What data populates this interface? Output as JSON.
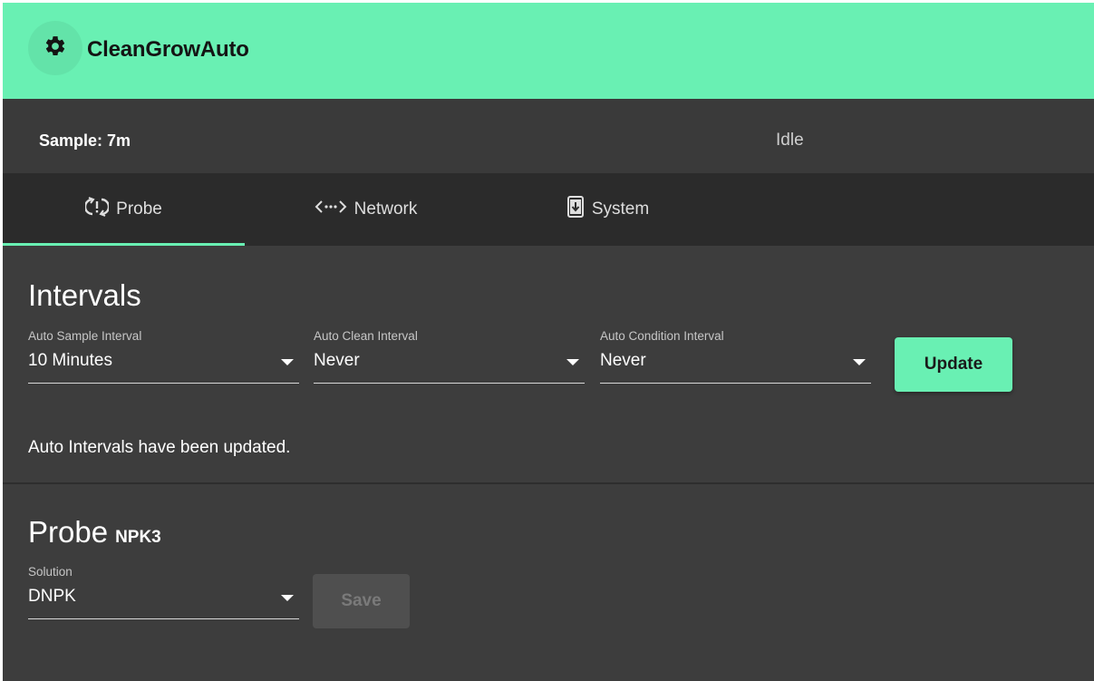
{
  "app": {
    "title": "CleanGrowAuto",
    "icon": "gear-icon"
  },
  "status": {
    "sample": "Sample: 7m",
    "state": "Idle"
  },
  "tabs": [
    {
      "label": "Probe",
      "icon": "probe-refresh-icon",
      "active": true
    },
    {
      "label": "Network",
      "icon": "network-dots-icon",
      "active": false
    },
    {
      "label": "System",
      "icon": "system-update-icon",
      "active": false
    }
  ],
  "intervals": {
    "title": "Intervals",
    "fields": [
      {
        "label": "Auto Sample Interval",
        "value": "10 Minutes"
      },
      {
        "label": "Auto Clean Interval",
        "value": "Never"
      },
      {
        "label": "Auto Condition Interval",
        "value": "Never"
      }
    ],
    "update_label": "Update",
    "message": "Auto Intervals have been updated."
  },
  "probe": {
    "title": "Probe",
    "model": "NPK3",
    "solution_label": "Solution",
    "solution_value": "DNPK",
    "save_label": "Save"
  },
  "colors": {
    "accent": "#69f0b3",
    "background": "#3d3d3d",
    "tabbar": "#2b2b2b"
  }
}
